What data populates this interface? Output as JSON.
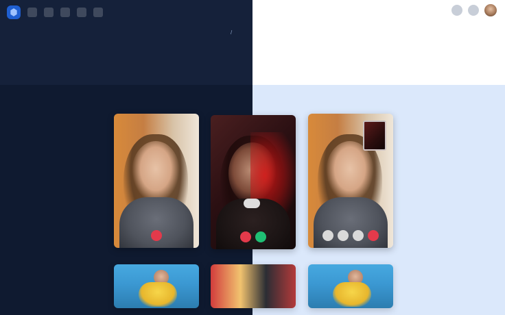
{
  "header": {
    "breadcrumb": {
      "items": [
        "",
        ""
      ],
      "separator": "/"
    },
    "title": "",
    "description": ""
  },
  "tabs": [
    {
      "label": "",
      "active": true
    },
    {
      "label": "",
      "active": false
    }
  ],
  "cards": [
    {
      "caption": ""
    },
    {
      "caption": ""
    },
    {
      "caption": ""
    }
  ],
  "thumbnails": [
    {
      "caption": ""
    },
    {
      "caption": ""
    },
    {
      "caption": ""
    }
  ],
  "colors": {
    "dark_panel": "#15213a",
    "dark_background": "#0f1a30",
    "light_panel": "#ffffff",
    "light_background": "#dbe8fb",
    "accent": "#3d7ff2",
    "call_end": "#e33a4b",
    "call_accept": "#1fbf74"
  },
  "icons": {
    "logo": "app-logo-icon",
    "nav": [
      "grid-icon",
      "chat-icon",
      "phone-icon",
      "pen-icon",
      "settings-icon"
    ],
    "right": [
      "bell-icon",
      "help-icon",
      "user-avatar"
    ],
    "controls": [
      "mic-icon",
      "video-icon",
      "end-call-icon",
      "accept-call-icon"
    ]
  }
}
